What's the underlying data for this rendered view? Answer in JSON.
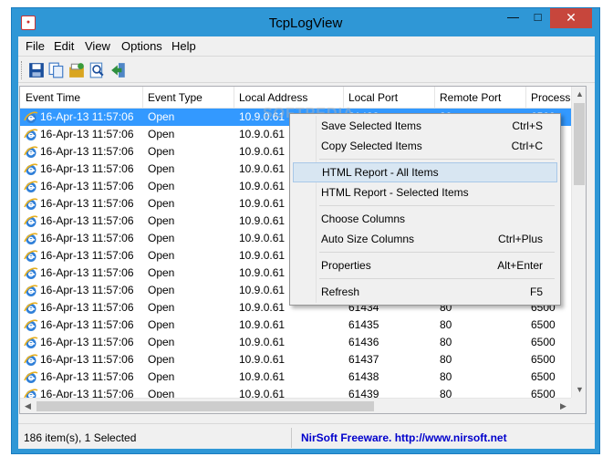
{
  "window": {
    "title": "TcpLogView"
  },
  "menu": [
    "File",
    "Edit",
    "View",
    "Options",
    "Help"
  ],
  "toolbar": {
    "buttons": [
      {
        "name": "save-icon",
        "color": "#1b4f9c"
      },
      {
        "name": "copy-icon",
        "color": "#3a76c4"
      },
      {
        "name": "html-report-icon",
        "color": "#d9a520"
      },
      {
        "name": "find-icon",
        "color": "#4f86c6"
      },
      {
        "name": "exit-icon",
        "color": "#2f8f3f"
      }
    ]
  },
  "columns": [
    "Event Time",
    "Event Type",
    "Local Address",
    "Local Port",
    "Remote Port",
    "Process"
  ],
  "rows": [
    [
      "16-Apr-13 11:57:06",
      "Open",
      "10.9.0.61",
      "61433",
      "80",
      "6500"
    ],
    [
      "16-Apr-13 11:57:06",
      "Open",
      "10.9.0.61",
      "",
      "",
      ""
    ],
    [
      "16-Apr-13 11:57:06",
      "Open",
      "10.9.0.61",
      "",
      "",
      ""
    ],
    [
      "16-Apr-13 11:57:06",
      "Open",
      "10.9.0.61",
      "",
      "",
      ""
    ],
    [
      "16-Apr-13 11:57:06",
      "Open",
      "10.9.0.61",
      "",
      "",
      ""
    ],
    [
      "16-Apr-13 11:57:06",
      "Open",
      "10.9.0.61",
      "",
      "",
      ""
    ],
    [
      "16-Apr-13 11:57:06",
      "Open",
      "10.9.0.61",
      "",
      "",
      ""
    ],
    [
      "16-Apr-13 11:57:06",
      "Open",
      "10.9.0.61",
      "",
      "",
      ""
    ],
    [
      "16-Apr-13 11:57:06",
      "Open",
      "10.9.0.61",
      "",
      "",
      ""
    ],
    [
      "16-Apr-13 11:57:06",
      "Open",
      "10.9.0.61",
      "",
      "",
      ""
    ],
    [
      "16-Apr-13 11:57:06",
      "Open",
      "10.9.0.61",
      "",
      "",
      ""
    ],
    [
      "16-Apr-13 11:57:06",
      "Open",
      "10.9.0.61",
      "61434",
      "80",
      "6500"
    ],
    [
      "16-Apr-13 11:57:06",
      "Open",
      "10.9.0.61",
      "61435",
      "80",
      "6500"
    ],
    [
      "16-Apr-13 11:57:06",
      "Open",
      "10.9.0.61",
      "61436",
      "80",
      "6500"
    ],
    [
      "16-Apr-13 11:57:06",
      "Open",
      "10.9.0.61",
      "61437",
      "80",
      "6500"
    ],
    [
      "16-Apr-13 11:57:06",
      "Open",
      "10.9.0.61",
      "61438",
      "80",
      "6500"
    ],
    [
      "16-Apr-13 11:57:06",
      "Open",
      "10.9.0.61",
      "61439",
      "80",
      "6500"
    ]
  ],
  "selected_row": 0,
  "context_menu": [
    {
      "label": "Save Selected Items",
      "shortcut": "Ctrl+S"
    },
    {
      "label": "Copy Selected Items",
      "shortcut": "Ctrl+C"
    },
    {
      "separator": true
    },
    {
      "label": "HTML Report - All Items",
      "shortcut": "",
      "hover": true
    },
    {
      "label": "HTML Report - Selected Items",
      "shortcut": ""
    },
    {
      "separator": true
    },
    {
      "label": "Choose Columns",
      "shortcut": ""
    },
    {
      "label": "Auto Size Columns",
      "shortcut": "Ctrl+Plus"
    },
    {
      "separator": true
    },
    {
      "label": "Properties",
      "shortcut": "Alt+Enter"
    },
    {
      "separator": true
    },
    {
      "label": "Refresh",
      "shortcut": "F5"
    }
  ],
  "status": {
    "items": "186 item(s), 1 Selected",
    "credit": "NirSoft Freeware.  http://www.nirsoft.net"
  },
  "watermark": "SOFTPEDIA",
  "colors": {
    "titlebar": "#2f97d6",
    "close_button": "#c7463c",
    "selection": "#3399ff",
    "menu_hover": "#d8e6f2",
    "link": "#0000cc"
  }
}
